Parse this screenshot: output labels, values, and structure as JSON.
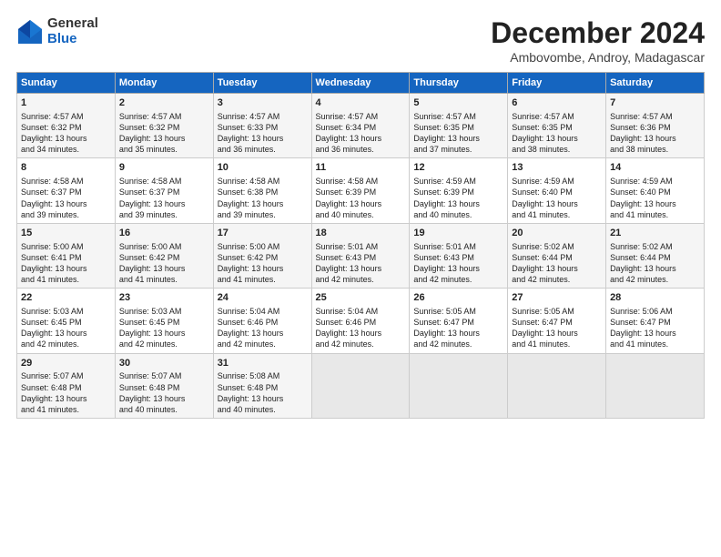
{
  "logo": {
    "general": "General",
    "blue": "Blue"
  },
  "title": "December 2024",
  "subtitle": "Ambovombe, Androy, Madagascar",
  "days_header": [
    "Sunday",
    "Monday",
    "Tuesday",
    "Wednesday",
    "Thursday",
    "Friday",
    "Saturday"
  ],
  "weeks": [
    [
      {
        "day": "1",
        "lines": [
          "Sunrise: 4:57 AM",
          "Sunset: 6:32 PM",
          "Daylight: 13 hours",
          "and 34 minutes."
        ]
      },
      {
        "day": "2",
        "lines": [
          "Sunrise: 4:57 AM",
          "Sunset: 6:32 PM",
          "Daylight: 13 hours",
          "and 35 minutes."
        ]
      },
      {
        "day": "3",
        "lines": [
          "Sunrise: 4:57 AM",
          "Sunset: 6:33 PM",
          "Daylight: 13 hours",
          "and 36 minutes."
        ]
      },
      {
        "day": "4",
        "lines": [
          "Sunrise: 4:57 AM",
          "Sunset: 6:34 PM",
          "Daylight: 13 hours",
          "and 36 minutes."
        ]
      },
      {
        "day": "5",
        "lines": [
          "Sunrise: 4:57 AM",
          "Sunset: 6:35 PM",
          "Daylight: 13 hours",
          "and 37 minutes."
        ]
      },
      {
        "day": "6",
        "lines": [
          "Sunrise: 4:57 AM",
          "Sunset: 6:35 PM",
          "Daylight: 13 hours",
          "and 38 minutes."
        ]
      },
      {
        "day": "7",
        "lines": [
          "Sunrise: 4:57 AM",
          "Sunset: 6:36 PM",
          "Daylight: 13 hours",
          "and 38 minutes."
        ]
      }
    ],
    [
      {
        "day": "8",
        "lines": [
          "Sunrise: 4:58 AM",
          "Sunset: 6:37 PM",
          "Daylight: 13 hours",
          "and 39 minutes."
        ]
      },
      {
        "day": "9",
        "lines": [
          "Sunrise: 4:58 AM",
          "Sunset: 6:37 PM",
          "Daylight: 13 hours",
          "and 39 minutes."
        ]
      },
      {
        "day": "10",
        "lines": [
          "Sunrise: 4:58 AM",
          "Sunset: 6:38 PM",
          "Daylight: 13 hours",
          "and 39 minutes."
        ]
      },
      {
        "day": "11",
        "lines": [
          "Sunrise: 4:58 AM",
          "Sunset: 6:39 PM",
          "Daylight: 13 hours",
          "and 40 minutes."
        ]
      },
      {
        "day": "12",
        "lines": [
          "Sunrise: 4:59 AM",
          "Sunset: 6:39 PM",
          "Daylight: 13 hours",
          "and 40 minutes."
        ]
      },
      {
        "day": "13",
        "lines": [
          "Sunrise: 4:59 AM",
          "Sunset: 6:40 PM",
          "Daylight: 13 hours",
          "and 41 minutes."
        ]
      },
      {
        "day": "14",
        "lines": [
          "Sunrise: 4:59 AM",
          "Sunset: 6:40 PM",
          "Daylight: 13 hours",
          "and 41 minutes."
        ]
      }
    ],
    [
      {
        "day": "15",
        "lines": [
          "Sunrise: 5:00 AM",
          "Sunset: 6:41 PM",
          "Daylight: 13 hours",
          "and 41 minutes."
        ]
      },
      {
        "day": "16",
        "lines": [
          "Sunrise: 5:00 AM",
          "Sunset: 6:42 PM",
          "Daylight: 13 hours",
          "and 41 minutes."
        ]
      },
      {
        "day": "17",
        "lines": [
          "Sunrise: 5:00 AM",
          "Sunset: 6:42 PM",
          "Daylight: 13 hours",
          "and 41 minutes."
        ]
      },
      {
        "day": "18",
        "lines": [
          "Sunrise: 5:01 AM",
          "Sunset: 6:43 PM",
          "Daylight: 13 hours",
          "and 42 minutes."
        ]
      },
      {
        "day": "19",
        "lines": [
          "Sunrise: 5:01 AM",
          "Sunset: 6:43 PM",
          "Daylight: 13 hours",
          "and 42 minutes."
        ]
      },
      {
        "day": "20",
        "lines": [
          "Sunrise: 5:02 AM",
          "Sunset: 6:44 PM",
          "Daylight: 13 hours",
          "and 42 minutes."
        ]
      },
      {
        "day": "21",
        "lines": [
          "Sunrise: 5:02 AM",
          "Sunset: 6:44 PM",
          "Daylight: 13 hours",
          "and 42 minutes."
        ]
      }
    ],
    [
      {
        "day": "22",
        "lines": [
          "Sunrise: 5:03 AM",
          "Sunset: 6:45 PM",
          "Daylight: 13 hours",
          "and 42 minutes."
        ]
      },
      {
        "day": "23",
        "lines": [
          "Sunrise: 5:03 AM",
          "Sunset: 6:45 PM",
          "Daylight: 13 hours",
          "and 42 minutes."
        ]
      },
      {
        "day": "24",
        "lines": [
          "Sunrise: 5:04 AM",
          "Sunset: 6:46 PM",
          "Daylight: 13 hours",
          "and 42 minutes."
        ]
      },
      {
        "day": "25",
        "lines": [
          "Sunrise: 5:04 AM",
          "Sunset: 6:46 PM",
          "Daylight: 13 hours",
          "and 42 minutes."
        ]
      },
      {
        "day": "26",
        "lines": [
          "Sunrise: 5:05 AM",
          "Sunset: 6:47 PM",
          "Daylight: 13 hours",
          "and 42 minutes."
        ]
      },
      {
        "day": "27",
        "lines": [
          "Sunrise: 5:05 AM",
          "Sunset: 6:47 PM",
          "Daylight: 13 hours",
          "and 41 minutes."
        ]
      },
      {
        "day": "28",
        "lines": [
          "Sunrise: 5:06 AM",
          "Sunset: 6:47 PM",
          "Daylight: 13 hours",
          "and 41 minutes."
        ]
      }
    ],
    [
      {
        "day": "29",
        "lines": [
          "Sunrise: 5:07 AM",
          "Sunset: 6:48 PM",
          "Daylight: 13 hours",
          "and 41 minutes."
        ]
      },
      {
        "day": "30",
        "lines": [
          "Sunrise: 5:07 AM",
          "Sunset: 6:48 PM",
          "Daylight: 13 hours",
          "and 40 minutes."
        ]
      },
      {
        "day": "31",
        "lines": [
          "Sunrise: 5:08 AM",
          "Sunset: 6:48 PM",
          "Daylight: 13 hours",
          "and 40 minutes."
        ]
      },
      null,
      null,
      null,
      null
    ]
  ]
}
